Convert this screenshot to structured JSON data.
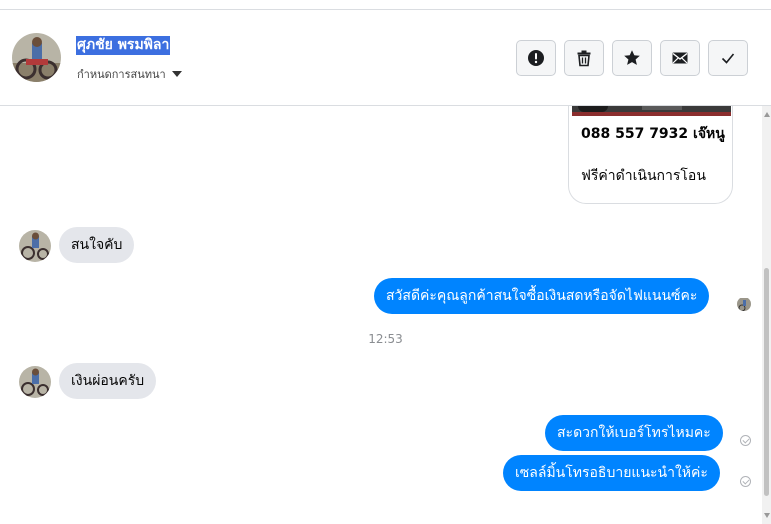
{
  "contact": {
    "name": "ศุภชัย พรมพิลา",
    "menu_label": "กำหนดการสนทนา"
  },
  "actions": [
    {
      "icon": "alert-icon",
      "label": "report"
    },
    {
      "icon": "trash-icon",
      "label": "delete"
    },
    {
      "icon": "star-icon",
      "label": "star"
    },
    {
      "icon": "envelope-icon",
      "label": "mark unread"
    },
    {
      "icon": "checkmark-icon",
      "label": "done"
    }
  ],
  "card": {
    "phone_line": "088 557 7932 เจ๊หนู",
    "fee_line": "ฟรีค่าดำเนินการโอน"
  },
  "messages": {
    "m1": "สนใจคับ",
    "m2": "สวัสดีค่ะคุณลูกค้าสนใจซื้อเงินสดหรือจัดไฟแนนซ์คะ",
    "time": "12:53",
    "m3": "เงินผ่อนครับ",
    "m4": "สะดวกให้เบอร์โทรไหมคะ",
    "m5": "เซลล์มิ้นโทรอธิบายแนะนำให้ค่ะ"
  },
  "colors": {
    "outgoing": "#0084ff",
    "incoming": "#e4e6eb",
    "name_highlight": "#3c6fe0"
  }
}
